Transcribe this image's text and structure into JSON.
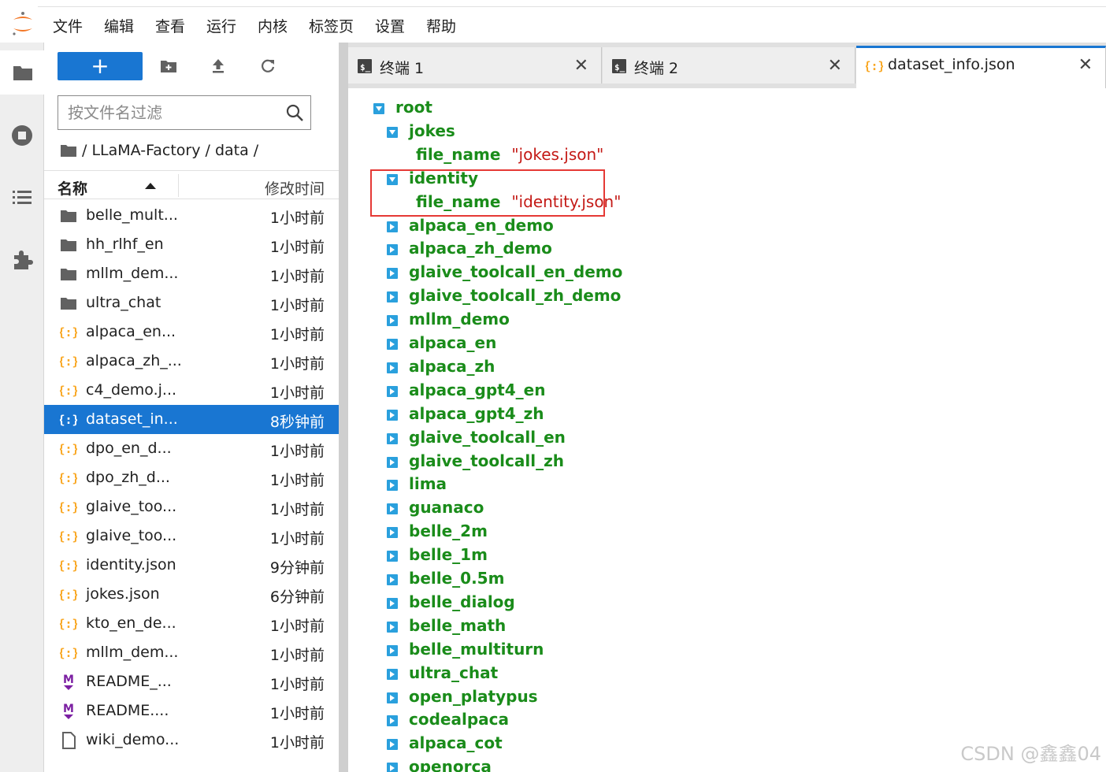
{
  "menu": [
    "文件",
    "编辑",
    "查看",
    "运行",
    "内核",
    "标签页",
    "设置",
    "帮助"
  ],
  "filebrowser": {
    "new_label": "+",
    "filter_placeholder": "按文件名过滤",
    "breadcrumb": "/ LLaMA-Factory / data /",
    "col_name": "名称",
    "col_modified": "修改时间",
    "files": [
      {
        "name": "belle_mult...",
        "time": "1小时前",
        "icon": "folder-icon"
      },
      {
        "name": "hh_rlhf_en",
        "time": "1小时前",
        "icon": "folder-icon"
      },
      {
        "name": "mllm_dem...",
        "time": "1小时前",
        "icon": "folder-icon"
      },
      {
        "name": "ultra_chat",
        "time": "1小时前",
        "icon": "folder-icon"
      },
      {
        "name": "alpaca_en...",
        "time": "1小时前",
        "icon": "json-file-icon"
      },
      {
        "name": "alpaca_zh_...",
        "time": "1小时前",
        "icon": "json-file-icon"
      },
      {
        "name": "c4_demo.j...",
        "time": "1小时前",
        "icon": "json-file-icon"
      },
      {
        "name": "dataset_in...",
        "time": "8秒钟前",
        "icon": "json-file-icon",
        "selected": true
      },
      {
        "name": "dpo_en_d...",
        "time": "1小时前",
        "icon": "json-file-icon"
      },
      {
        "name": "dpo_zh_d...",
        "time": "1小时前",
        "icon": "json-file-icon"
      },
      {
        "name": "glaive_too...",
        "time": "1小时前",
        "icon": "json-file-icon"
      },
      {
        "name": "glaive_too...",
        "time": "1小时前",
        "icon": "json-file-icon"
      },
      {
        "name": "identity.json",
        "time": "9分钟前",
        "icon": "json-file-icon"
      },
      {
        "name": "jokes.json",
        "time": "6分钟前",
        "icon": "json-file-icon"
      },
      {
        "name": "kto_en_de...",
        "time": "1小时前",
        "icon": "json-file-icon"
      },
      {
        "name": "mllm_dem...",
        "time": "1小时前",
        "icon": "json-file-icon"
      },
      {
        "name": "README_...",
        "time": "1小时前",
        "icon": "markdown-file-icon"
      },
      {
        "name": "README....",
        "time": "1小时前",
        "icon": "markdown-file-icon"
      },
      {
        "name": "wiki_demo...",
        "time": "1小时前",
        "icon": "text-file-icon"
      }
    ]
  },
  "tabs": [
    {
      "label": "终端 1",
      "icon": "terminal-icon"
    },
    {
      "label": "终端 2",
      "icon": "terminal-icon"
    },
    {
      "label": "dataset_info.json",
      "icon": "json-file-icon",
      "active": true
    }
  ],
  "json_tree": {
    "root_key": "root",
    "expanded": [
      {
        "key": "jokes",
        "child_key": "file_name",
        "child_value": "\"jokes.json\""
      },
      {
        "key": "identity",
        "child_key": "file_name",
        "child_value": "\"identity.json\""
      }
    ],
    "collapsed": [
      "alpaca_en_demo",
      "alpaca_zh_demo",
      "glaive_toolcall_en_demo",
      "glaive_toolcall_zh_demo",
      "mllm_demo",
      "alpaca_en",
      "alpaca_zh",
      "alpaca_gpt4_en",
      "alpaca_gpt4_zh",
      "glaive_toolcall_en",
      "glaive_toolcall_zh",
      "lima",
      "guanaco",
      "belle_2m",
      "belle_1m",
      "belle_0.5m",
      "belle_dialog",
      "belle_math",
      "belle_multiturn",
      "ultra_chat",
      "open_platypus",
      "codealpaca",
      "alpaca_cot",
      "openorca"
    ]
  },
  "watermark": "CSDN @鑫鑫04",
  "colors": {
    "accent": "#1976d2",
    "json_key": "#1a8c1a",
    "json_string": "#c41a16",
    "toggle": "#2aa0dd",
    "highlight": "#e53935"
  }
}
